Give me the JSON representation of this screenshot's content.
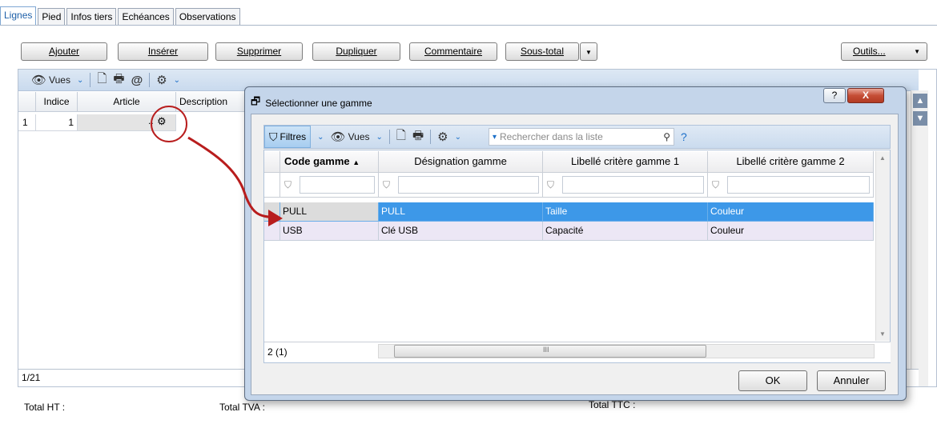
{
  "tabs": [
    "Lignes",
    "Pied",
    "Infos tiers",
    "Echéances",
    "Observations"
  ],
  "toolbar": {
    "ajouter": "Ajouter",
    "inserer": "Insérer",
    "supprimer": "Supprimer",
    "dupliquer": "Dupliquer",
    "commentaire": "Commentaire",
    "sous_total": "Sous-total",
    "outils": "Outils..."
  },
  "grid": {
    "vues_label": "Vues",
    "headers": [
      "Indice",
      "Article",
      "Description"
    ],
    "row_num": "1",
    "row_indice": "1",
    "row_article_ellipsis": "..",
    "footer_count": "1/21"
  },
  "totals": {
    "ht": "Total HT :",
    "tva": "Total TVA :",
    "ttc": "Total TTC :"
  },
  "dialog": {
    "title": "Sélectionner une gamme",
    "help": "?",
    "close": "X",
    "filters_label": "Filtres",
    "vues_label": "Vues",
    "search_placeholder": "Rechercher dans la liste",
    "question": "?",
    "headers": [
      "Code gamme",
      "Désignation gamme",
      "Libellé critère gamme 1",
      "Libellé critère gamme 2"
    ],
    "rows": [
      [
        "PULL",
        "PULL",
        "Taille",
        "Couleur"
      ],
      [
        "USB",
        "Clé USB",
        "Capacité",
        "Couleur"
      ]
    ],
    "footer_count": "2 (1)",
    "hscroll_grip": "III",
    "ok": "OK",
    "annuler": "Annuler"
  },
  "colors": {
    "selected_row": "#3d98e8",
    "annotation": "#b81d1d",
    "dialog_frame": "#c4d5ea"
  },
  "icons": [
    "eye-icon",
    "preview-icon",
    "print-icon",
    "email-icon",
    "gear-icon",
    "funnel-icon",
    "search-icon",
    "chevron-down-icon",
    "scroll-up-icon",
    "scroll-down-icon"
  ]
}
